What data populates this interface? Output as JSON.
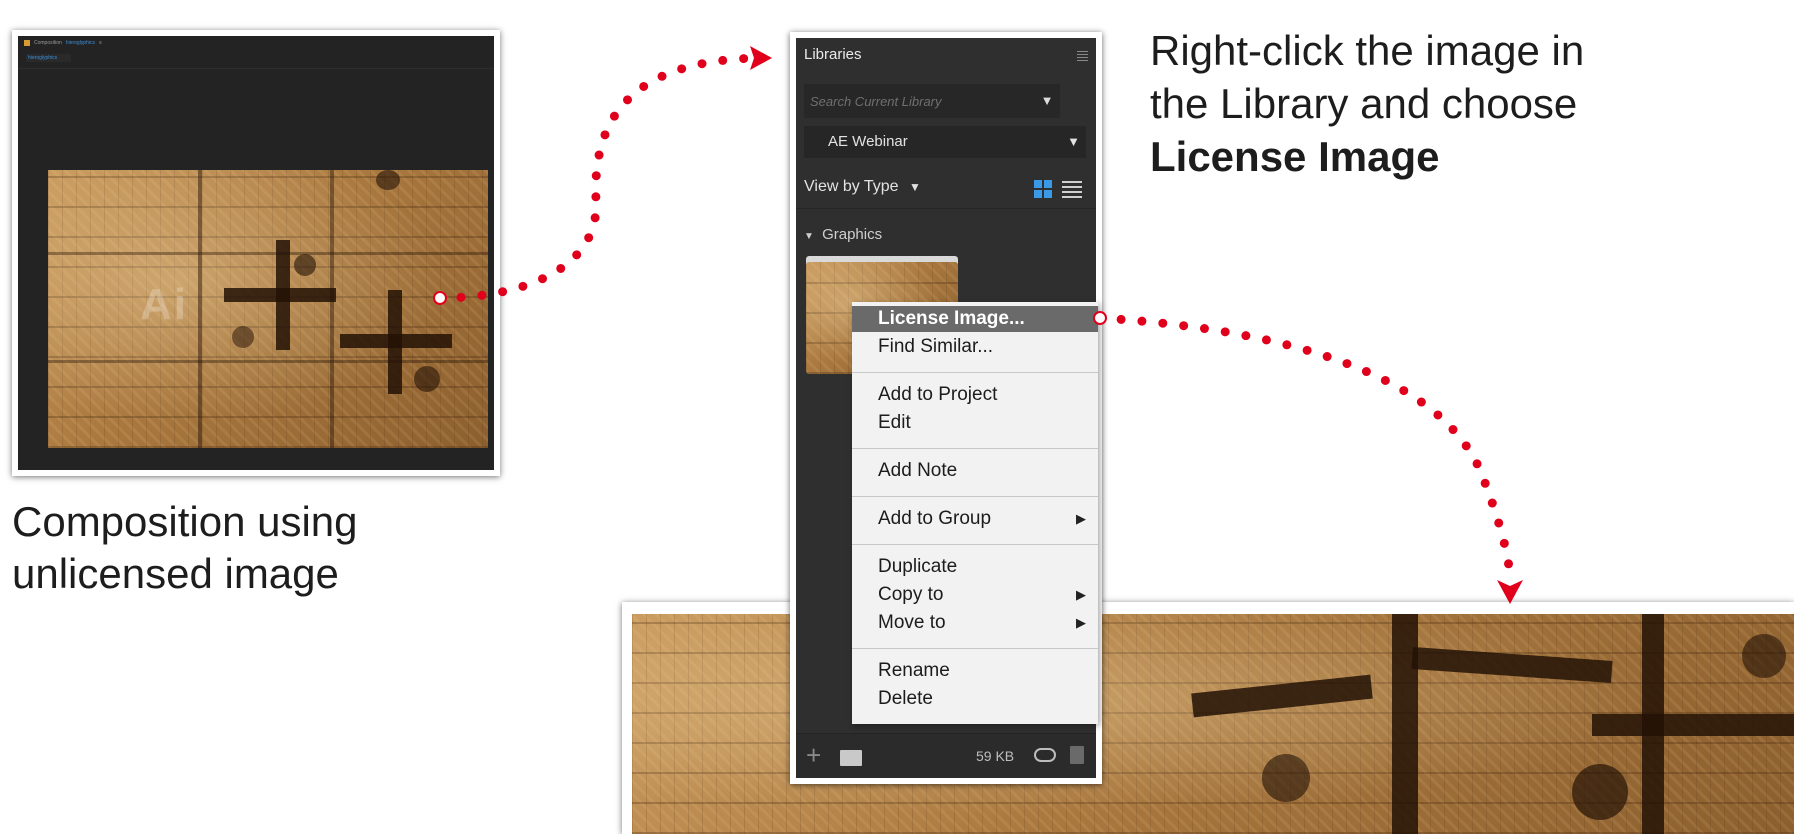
{
  "composition": {
    "tab_label": "Composition",
    "tab_name": "hieroglyphics",
    "tab_close": "≡",
    "subtab_label": "hieroglyphics",
    "watermark": "Ai",
    "caption_line1": "Composition using",
    "caption_line2": "unlicensed image"
  },
  "libraries_panel": {
    "title": "Libraries",
    "search_placeholder": "Search Current Library",
    "library_name": "AE Webinar",
    "view_by": "View by Type",
    "section": "Graphics",
    "footer_size": "59 KB"
  },
  "context_menu": {
    "items": [
      {
        "label": "License Image...",
        "highlighted": true
      },
      {
        "label": "Find Similar..."
      },
      {
        "label": "Add to Project"
      },
      {
        "label": "Edit"
      },
      {
        "label": "Add Note"
      },
      {
        "label": "Add to Group",
        "submenu": true
      },
      {
        "label": "Duplicate"
      },
      {
        "label": "Copy to",
        "submenu": true
      },
      {
        "label": "Move to",
        "submenu": true
      },
      {
        "label": "Rename"
      },
      {
        "label": "Delete"
      }
    ],
    "submenu_arrow": "▶"
  },
  "instruction": {
    "line1": "Right-click the image in",
    "line2": "the Library and choose",
    "bold": "License Image"
  },
  "colors": {
    "arrow_red": "#e0001b",
    "panel_bg": "#2f2f2f",
    "accent_blue": "#3b9ae8"
  },
  "icons": {
    "search_dropdown": "▼",
    "library_dropdown": "▼",
    "view_dropdown": "▼",
    "section_toggle": "▼",
    "add": "+"
  }
}
